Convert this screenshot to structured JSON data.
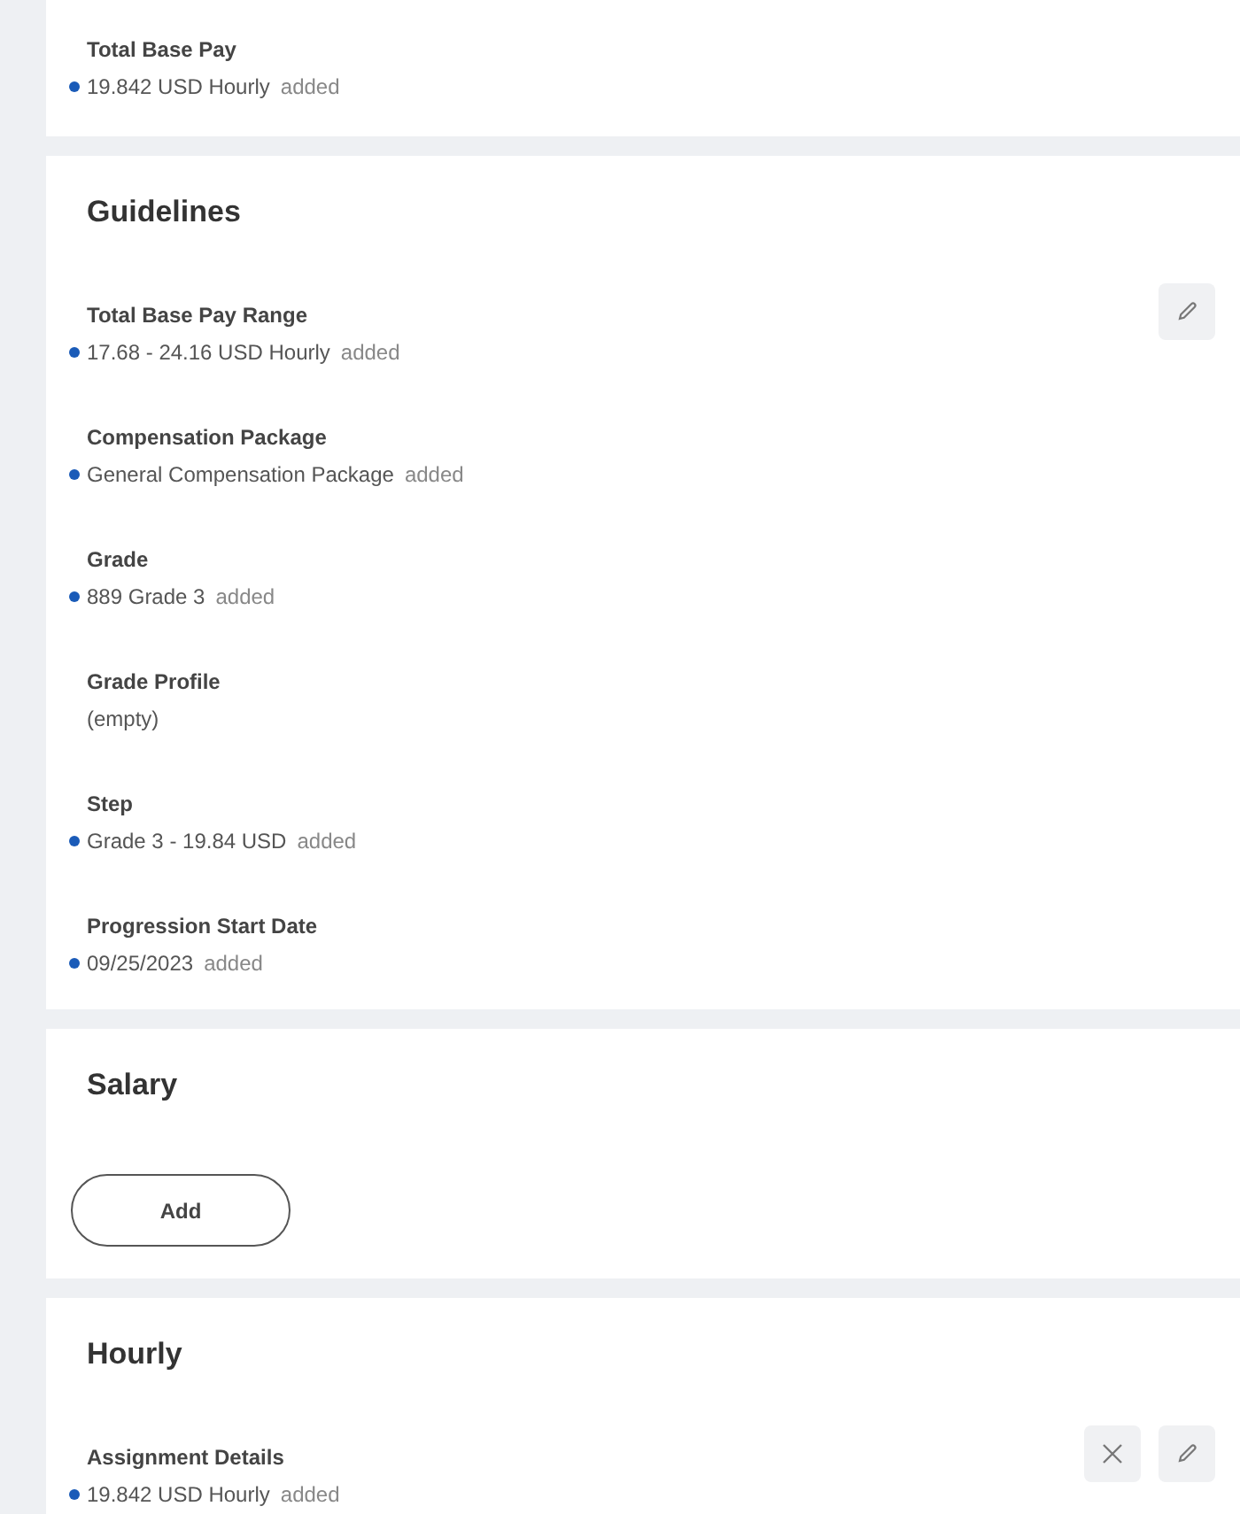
{
  "sections": [
    {
      "fields": [
        {
          "label": "Total Base Pay",
          "value": "19.842 USD Hourly",
          "status": "added",
          "changed": true
        }
      ]
    },
    {
      "title": "Guidelines",
      "fields": [
        {
          "label": "Total Base Pay Range",
          "value": "17.68 - 24.16 USD Hourly",
          "status": "added",
          "changed": true,
          "actions": [
            {
              "kind": "edit"
            }
          ]
        },
        {
          "label": "Compensation Package",
          "value": "General Compensation Package",
          "status": "added",
          "changed": true
        },
        {
          "label": "Grade",
          "value": "889 Grade 3",
          "status": "added",
          "changed": true
        },
        {
          "label": "Grade Profile",
          "value": "(empty)",
          "changed": false
        },
        {
          "label": "Step",
          "value": "Grade 3 - 19.84 USD",
          "status": "added",
          "changed": true
        },
        {
          "label": "Progression Start Date",
          "value": "09/25/2023",
          "status": "added",
          "changed": true
        }
      ]
    },
    {
      "title": "Salary",
      "buttons": [
        "Add"
      ]
    },
    {
      "title": "Hourly",
      "fields": [
        {
          "label": "Assignment Details",
          "value": "19.842 USD Hourly",
          "status": "added",
          "changed": true,
          "actions": [
            {
              "kind": "remove"
            },
            {
              "kind": "edit"
            }
          ]
        }
      ]
    }
  ]
}
